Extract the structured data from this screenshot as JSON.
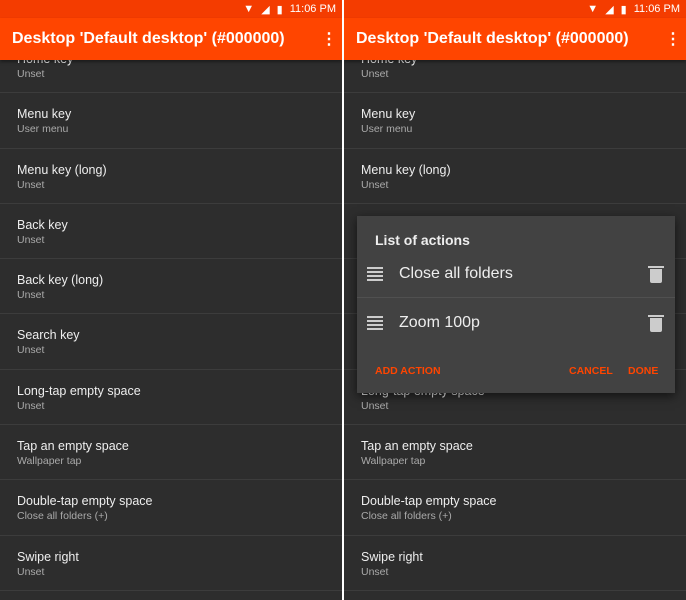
{
  "status": {
    "time": "11:06 PM"
  },
  "toolbar": {
    "title": "Desktop 'Default desktop' (#000000)"
  },
  "items": [
    {
      "title": "Home key",
      "subtitle": "Unset"
    },
    {
      "title": "Menu key",
      "subtitle": "User menu"
    },
    {
      "title": "Menu key (long)",
      "subtitle": "Unset"
    },
    {
      "title": "Back key",
      "subtitle": "Unset"
    },
    {
      "title": "Back key (long)",
      "subtitle": "Unset"
    },
    {
      "title": "Search key",
      "subtitle": "Unset"
    },
    {
      "title": "Long-tap empty space",
      "subtitle": "Unset"
    },
    {
      "title": "Tap an empty space",
      "subtitle": "Wallpaper tap"
    },
    {
      "title": "Double-tap empty space",
      "subtitle": "Close all folders (+)"
    },
    {
      "title": "Swipe right",
      "subtitle": "Unset"
    }
  ],
  "dialog": {
    "title": "List of actions",
    "actions": [
      "Close all folders",
      "Zoom 100p"
    ],
    "add": "ADD ACTION",
    "cancel": "CANCEL",
    "done": "DONE"
  },
  "colors": {
    "accent": "#ff4500",
    "status": "#f43c00",
    "background": "#2d2d2d",
    "dialog": "#424242"
  }
}
